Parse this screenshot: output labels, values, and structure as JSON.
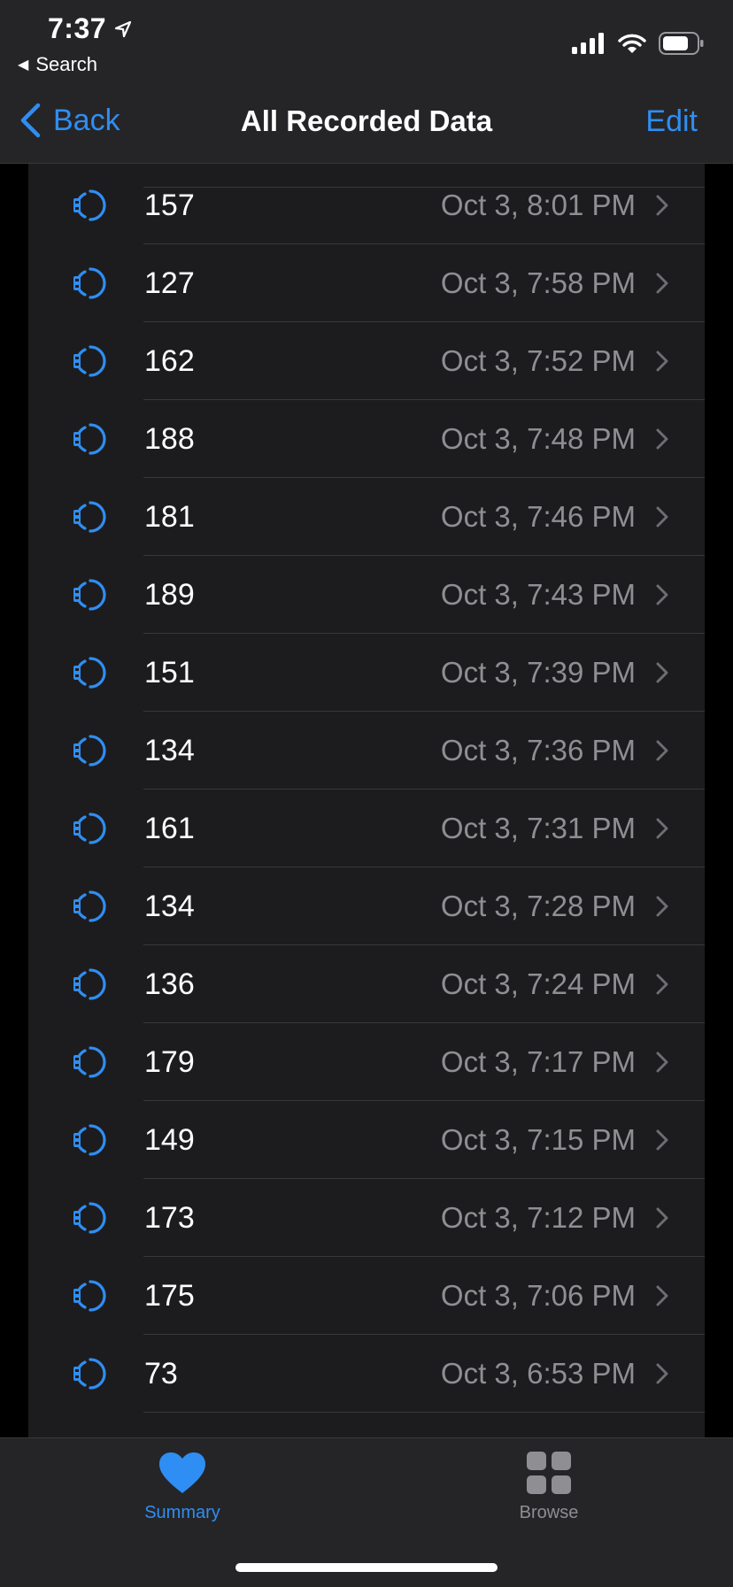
{
  "status_bar": {
    "time": "7:37",
    "back_app": "Search"
  },
  "nav": {
    "back_label": "Back",
    "title": "All Recorded Data",
    "edit_label": "Edit"
  },
  "rows": [
    {
      "value": "157",
      "date": "Oct 3, 8:01 PM"
    },
    {
      "value": "127",
      "date": "Oct 3, 7:58 PM"
    },
    {
      "value": "162",
      "date": "Oct 3, 7:52 PM"
    },
    {
      "value": "188",
      "date": "Oct 3, 7:48 PM"
    },
    {
      "value": "181",
      "date": "Oct 3, 7:46 PM"
    },
    {
      "value": "189",
      "date": "Oct 3, 7:43 PM"
    },
    {
      "value": "151",
      "date": "Oct 3, 7:39 PM"
    },
    {
      "value": "134",
      "date": "Oct 3, 7:36 PM"
    },
    {
      "value": "161",
      "date": "Oct 3, 7:31 PM"
    },
    {
      "value": "134",
      "date": "Oct 3, 7:28 PM"
    },
    {
      "value": "136",
      "date": "Oct 3, 7:24 PM"
    },
    {
      "value": "179",
      "date": "Oct 3, 7:17 PM"
    },
    {
      "value": "149",
      "date": "Oct 3, 7:15 PM"
    },
    {
      "value": "173",
      "date": "Oct 3, 7:12 PM"
    },
    {
      "value": "175",
      "date": "Oct 3, 7:06 PM"
    },
    {
      "value": "73",
      "date": "Oct 3, 6:53 PM"
    }
  ],
  "tabs": {
    "summary_label": "Summary",
    "browse_label": "Browse"
  },
  "icons": {
    "row_icon": "apple-watch-icon",
    "row_chevron": "chevron-right-icon"
  },
  "colors": {
    "accent": "#2f8ef3",
    "secondary_text": "#8e8e93"
  }
}
